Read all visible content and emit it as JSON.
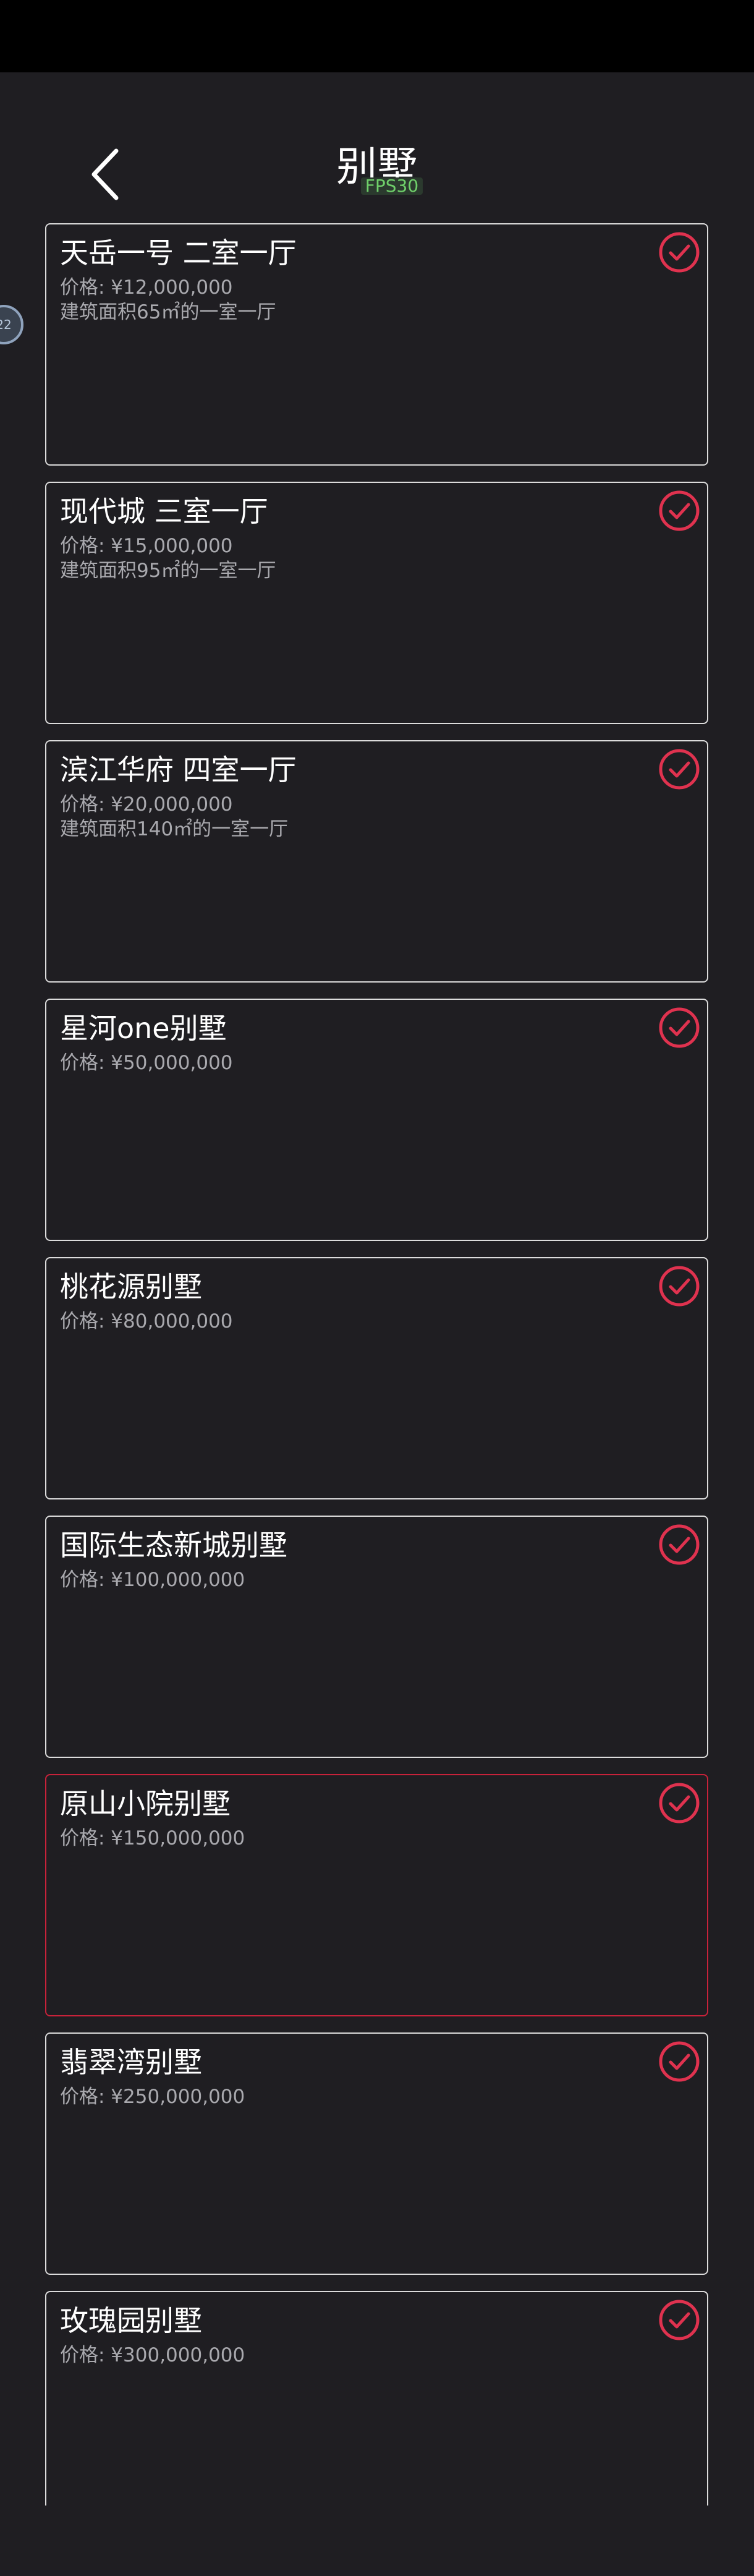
{
  "header": {
    "title": "别墅",
    "fps": "FPS30"
  },
  "colors": {
    "accent": "#e0324f",
    "card_border": "#dcdcdc",
    "selected_border": "#c8223a",
    "background": "#1f1e22"
  },
  "floating_ball": {
    "label": "22"
  },
  "cards": [
    {
      "title": "天岳一号 二室一厅",
      "price": "价格: ¥12,000,000",
      "desc": "建筑面积65㎡的一室一厅",
      "selected": false
    },
    {
      "title": "现代城 三室一厅",
      "price": "价格: ¥15,000,000",
      "desc": "建筑面积95㎡的一室一厅",
      "selected": false
    },
    {
      "title": "滨江华府 四室一厅",
      "price": "价格: ¥20,000,000",
      "desc": "建筑面积140㎡的一室一厅",
      "selected": false
    },
    {
      "title": "星河one别墅",
      "price": "价格: ¥50,000,000",
      "desc": "",
      "selected": false
    },
    {
      "title": "桃花源别墅",
      "price": "价格: ¥80,000,000",
      "desc": "",
      "selected": false
    },
    {
      "title": "国际生态新城别墅",
      "price": "价格: ¥100,000,000",
      "desc": "",
      "selected": false
    },
    {
      "title": "原山小院别墅",
      "price": "价格: ¥150,000,000",
      "desc": "",
      "selected": true
    },
    {
      "title": "翡翠湾别墅",
      "price": "价格: ¥250,000,000",
      "desc": "",
      "selected": false
    },
    {
      "title": "玫瑰园别墅",
      "price": "价格: ¥300,000,000",
      "desc": "",
      "selected": false
    }
  ]
}
